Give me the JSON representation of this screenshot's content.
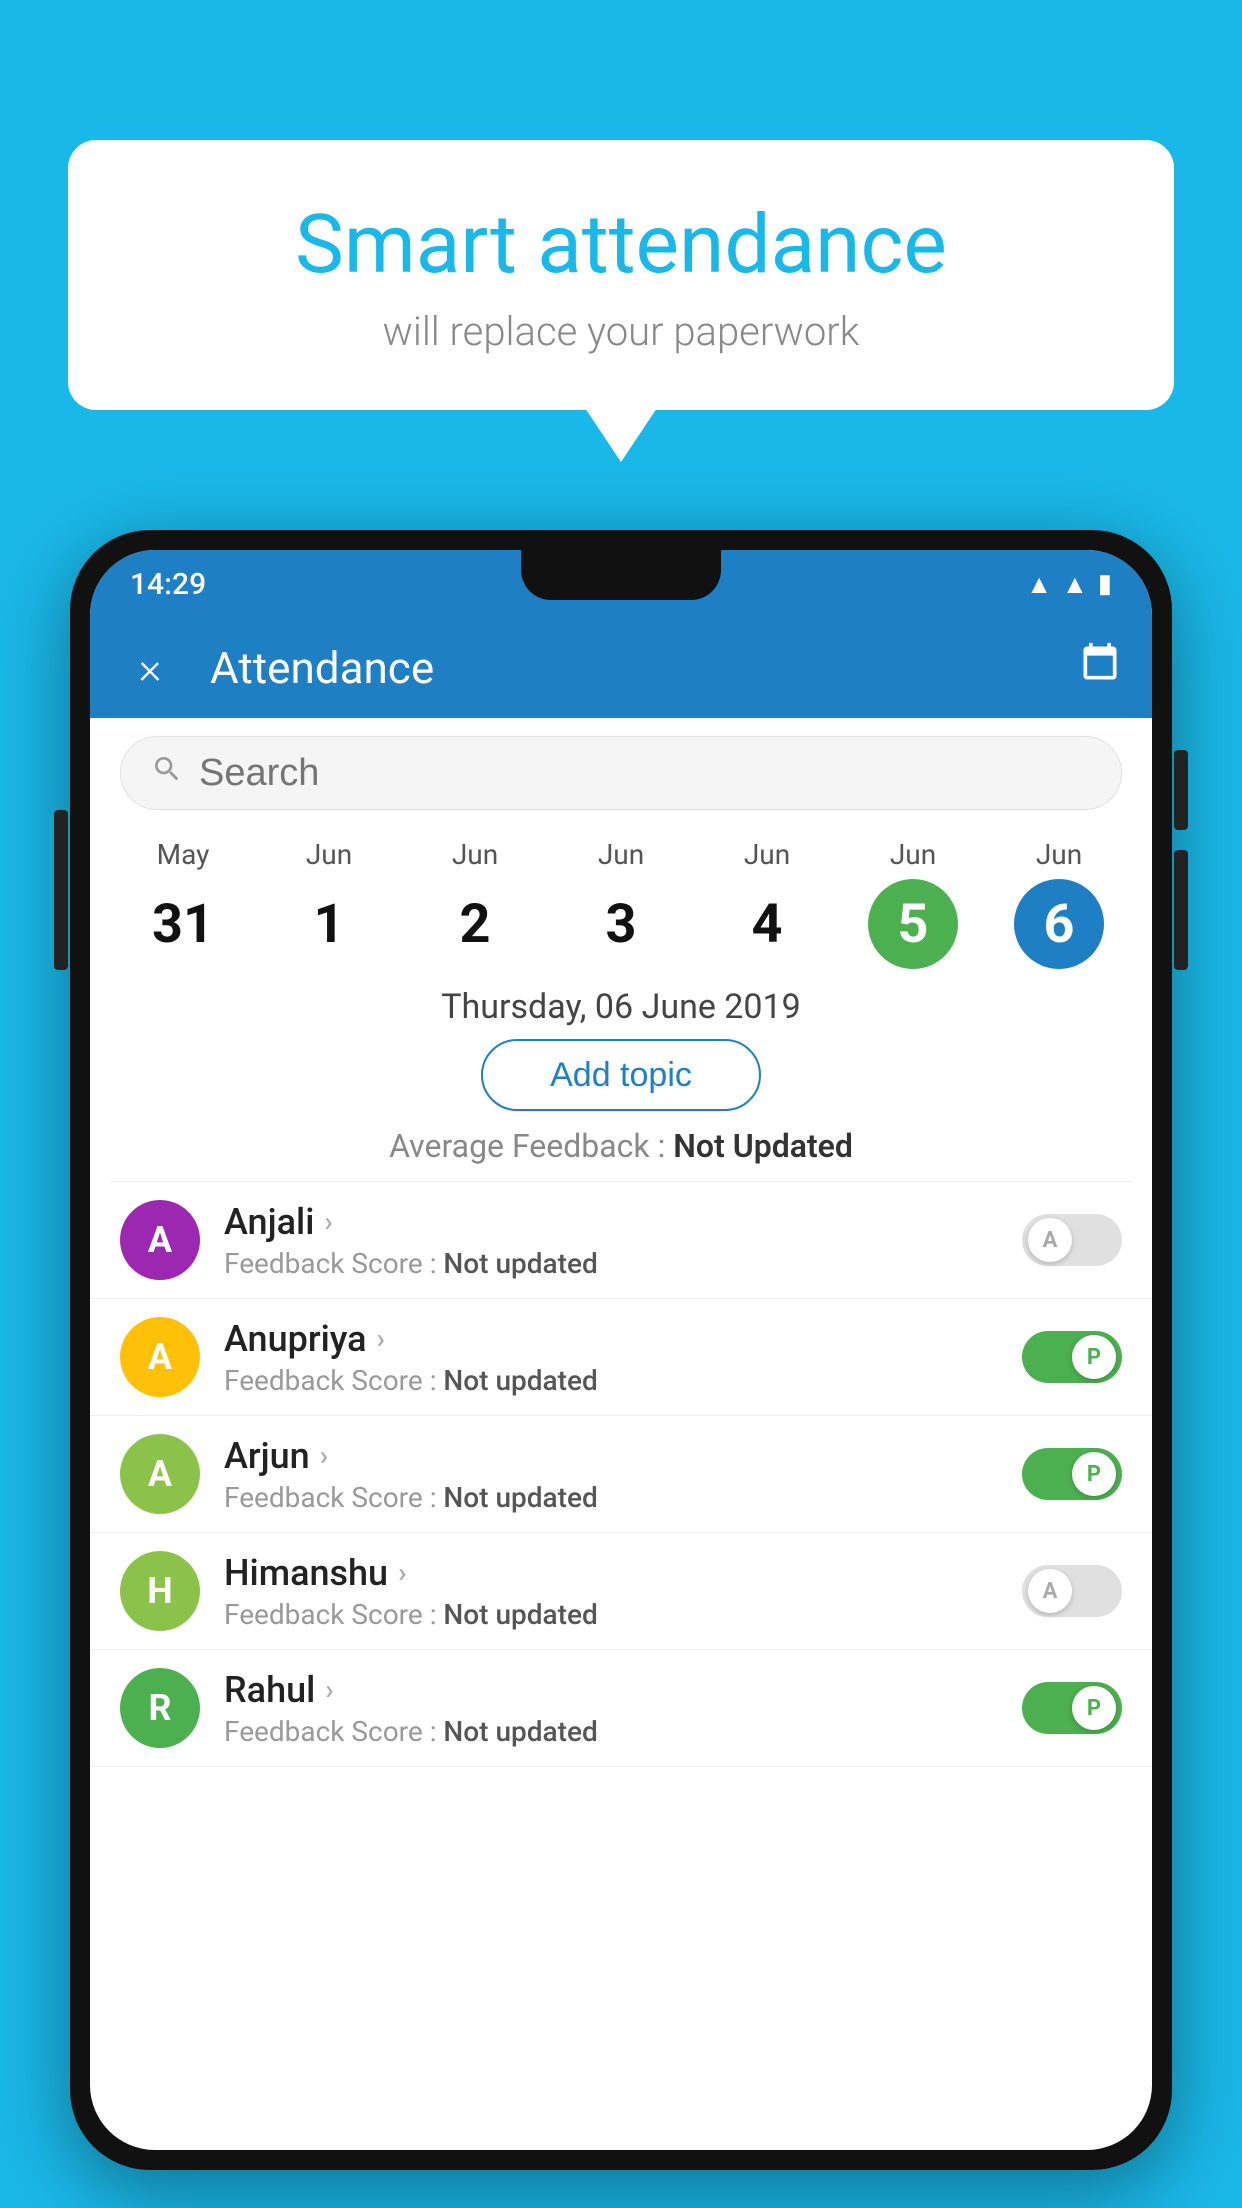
{
  "background_color": "#1ab8e8",
  "speech_bubble": {
    "title": "Smart attendance",
    "subtitle": "will replace your paperwork"
  },
  "status_bar": {
    "time": "14:29"
  },
  "app_bar": {
    "title": "Attendance",
    "close_label": "×",
    "calendar_icon": "📅"
  },
  "search": {
    "placeholder": "Search"
  },
  "calendar": {
    "days": [
      {
        "month": "May",
        "date": "31",
        "style": "normal"
      },
      {
        "month": "Jun",
        "date": "1",
        "style": "normal"
      },
      {
        "month": "Jun",
        "date": "2",
        "style": "normal"
      },
      {
        "month": "Jun",
        "date": "3",
        "style": "normal"
      },
      {
        "month": "Jun",
        "date": "4",
        "style": "normal"
      },
      {
        "month": "Jun",
        "date": "5",
        "style": "today"
      },
      {
        "month": "Jun",
        "date": "6",
        "style": "selected"
      }
    ]
  },
  "date_heading": "Thursday, 06 June 2019",
  "add_topic_label": "Add topic",
  "avg_feedback_label": "Average Feedback : ",
  "avg_feedback_value": "Not Updated",
  "students": [
    {
      "name": "Anjali",
      "feedback_label": "Feedback Score : ",
      "feedback_value": "Not updated",
      "avatar_letter": "A",
      "avatar_color": "#9c27b0",
      "attendance": "absent"
    },
    {
      "name": "Anupriya",
      "feedback_label": "Feedback Score : ",
      "feedback_value": "Not updated",
      "avatar_letter": "A",
      "avatar_color": "#ffc107",
      "attendance": "present"
    },
    {
      "name": "Arjun",
      "feedback_label": "Feedback Score : ",
      "feedback_value": "Not updated",
      "avatar_letter": "A",
      "avatar_color": "#8bc34a",
      "attendance": "present"
    },
    {
      "name": "Himanshu",
      "feedback_label": "Feedback Score : ",
      "feedback_value": "Not updated",
      "avatar_letter": "H",
      "avatar_color": "#8bc34a",
      "attendance": "absent"
    },
    {
      "name": "Rahul",
      "feedback_label": "Feedback Score : ",
      "feedback_value": "Not updated",
      "avatar_letter": "R",
      "avatar_color": "#4caf50",
      "attendance": "present"
    }
  ]
}
